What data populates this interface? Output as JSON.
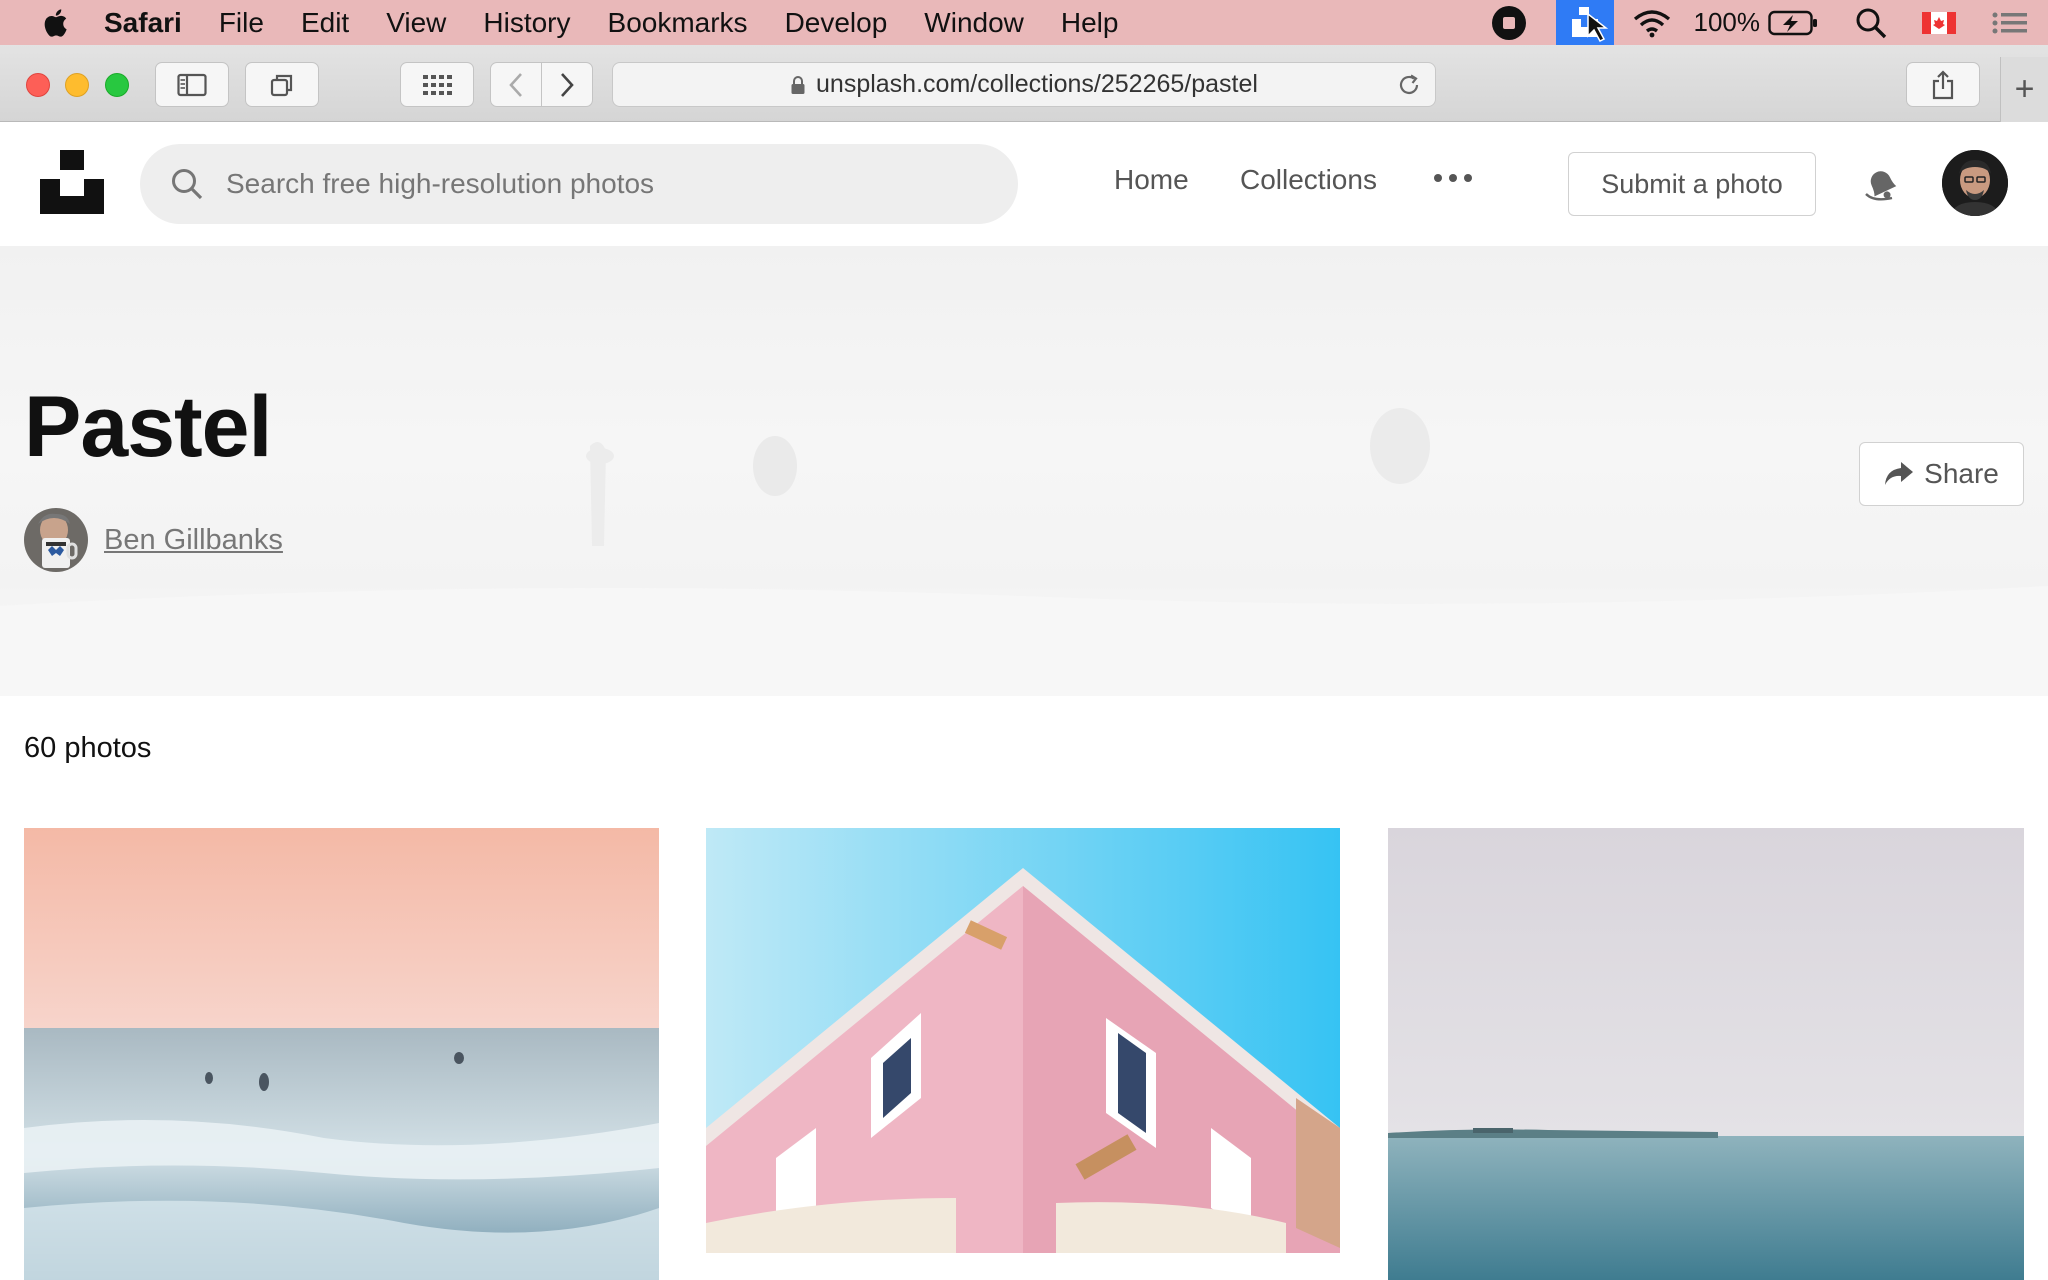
{
  "menubar": {
    "app_name": "Safari",
    "items": [
      "File",
      "Edit",
      "View",
      "History",
      "Bookmarks",
      "Develop",
      "Window",
      "Help"
    ],
    "battery": "100%"
  },
  "browser": {
    "url": "unsplash.com/collections/252265/pastel"
  },
  "header": {
    "search_placeholder": "Search free high-resolution photos",
    "nav": {
      "home": "Home",
      "collections": "Collections"
    },
    "submit_label": "Submit a photo"
  },
  "collection": {
    "title": "Pastel",
    "curator": "Ben Gillbanks",
    "share_label": "Share",
    "photo_count": "60 photos"
  },
  "colors": {
    "menubar_bg": "#e9b8b9",
    "tray_highlight": "#2f7bf5",
    "text_primary": "#111111",
    "text_secondary": "#767676"
  },
  "icons": [
    "apple-icon",
    "record-icon",
    "unsplash-tray-icon",
    "wifi-icon",
    "battery-icon",
    "spotlight-icon",
    "flag-icon",
    "notification-list-icon",
    "sidebar-icon",
    "tabs-icon",
    "grid-icon",
    "back-icon",
    "forward-icon",
    "lock-icon",
    "reload-icon",
    "share-icon",
    "new-tab-icon",
    "search-icon",
    "bell-icon",
    "more-icon"
  ]
}
